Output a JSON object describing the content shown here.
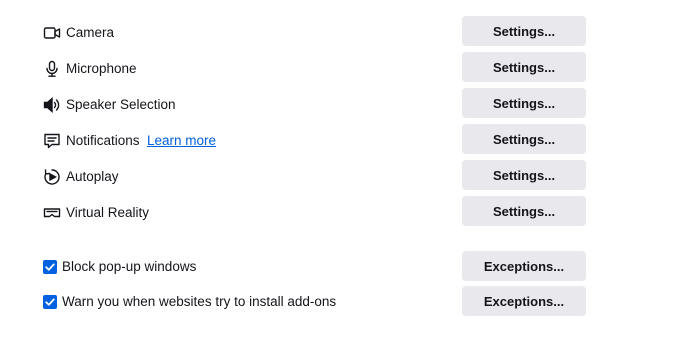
{
  "permissions": [
    {
      "label": "Camera",
      "icon": "camera-icon",
      "button": "Settings..."
    },
    {
      "label": "Microphone",
      "icon": "microphone-icon",
      "button": "Settings..."
    },
    {
      "label": "Speaker Selection",
      "icon": "speaker-icon",
      "button": "Settings..."
    },
    {
      "label": "Notifications",
      "icon": "notification-icon",
      "button": "Settings...",
      "link": "Learn more"
    },
    {
      "label": "Autoplay",
      "icon": "autoplay-icon",
      "button": "Settings..."
    },
    {
      "label": "Virtual Reality",
      "icon": "vr-headset-icon",
      "button": "Settings..."
    }
  ],
  "checkboxes": [
    {
      "label": "Block pop-up windows",
      "checked": true,
      "button": "Exceptions..."
    },
    {
      "label": "Warn you when websites try to install add-ons",
      "checked": true,
      "button": "Exceptions..."
    }
  ],
  "colors": {
    "accent": "#0061e0",
    "link": "#0061e0",
    "button_bg": "#e9e9ed",
    "text": "#15141a"
  }
}
